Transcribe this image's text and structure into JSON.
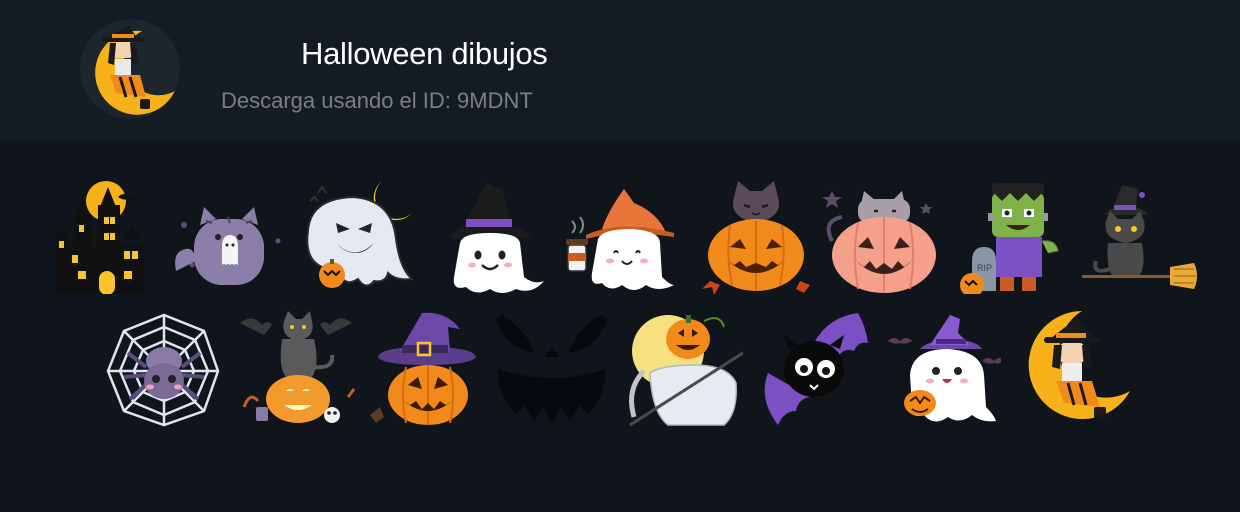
{
  "header": {
    "title": "Halloween dibujos",
    "subtitle": "Descarga usando el ID: 9MDNT",
    "avatar_icon": "witch-on-moon-icon"
  },
  "stickers_row1": [
    {
      "name": "haunted-house-icon"
    },
    {
      "name": "gray-cat-ghost-icon"
    },
    {
      "name": "ghost-moon-icon"
    },
    {
      "name": "ghost-witch-hat-icon"
    },
    {
      "name": "ghost-coffee-icon"
    },
    {
      "name": "cat-in-pumpkin-icon"
    },
    {
      "name": "cat-pumpkin-icon"
    },
    {
      "name": "frankenstein-icon"
    },
    {
      "name": "black-cat-broom-icon"
    }
  ],
  "stickers_row2": [
    {
      "name": "spider-web-icon"
    },
    {
      "name": "cat-bats-pumpkin-icon"
    },
    {
      "name": "witch-hat-pumpkin-icon"
    },
    {
      "name": "jack-o-lantern-face-icon"
    },
    {
      "name": "pumpkin-reaper-icon"
    },
    {
      "name": "cute-bat-icon"
    },
    {
      "name": "ghost-witch-pumpkin-icon"
    },
    {
      "name": "witch-on-moon-icon"
    }
  ],
  "colors": {
    "header_bg": "#141b22",
    "page_bg": "#0f151b",
    "title": "#ffffff",
    "subtitle": "#7a7f85",
    "orange": "#f28a1b",
    "moon": "#f7b21a",
    "purple": "#7c4fc4"
  }
}
